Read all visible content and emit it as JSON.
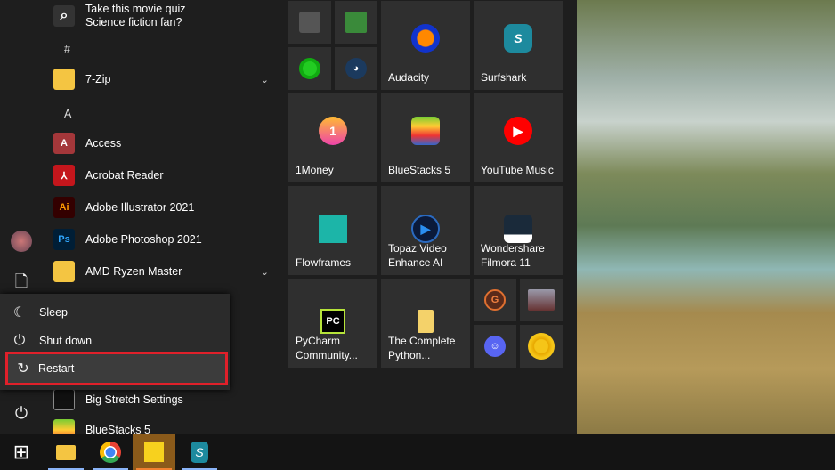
{
  "app_list": {
    "suggestion": {
      "line1": "Take this movie quiz",
      "line2": "Science fiction fan?",
      "icon": "search-icon"
    },
    "headers": [
      "#",
      "A"
    ],
    "items": [
      {
        "label": "7-Zip",
        "icon": "folder-icon",
        "expandable": true
      },
      {
        "label": "Access",
        "icon": "access-icon"
      },
      {
        "label": "Acrobat Reader",
        "icon": "acrobat-icon"
      },
      {
        "label": "Adobe Illustrator 2021",
        "icon": "illustrator-icon"
      },
      {
        "label": "Adobe Photoshop 2021",
        "icon": "photoshop-icon"
      },
      {
        "label": "AMD Ryzen Master",
        "icon": "folder-icon",
        "expandable": true
      },
      {
        "label": "Big Stretch Settings",
        "icon": "big-stretch-icon"
      },
      {
        "label": "BlueStacks 5",
        "icon": "bluestacks-icon"
      }
    ]
  },
  "power_menu": {
    "items": [
      {
        "label": "Sleep",
        "icon": "moon-icon"
      },
      {
        "label": "Shut down",
        "icon": "power-icon"
      },
      {
        "label": "Restart",
        "icon": "restart-icon",
        "highlighted": true
      }
    ],
    "highlight_color": "#e0202a"
  },
  "tiles": {
    "audacity": "Audacity",
    "surfshark": "Surfshark",
    "onemoney": "1Money",
    "bluestacks": "BlueStacks 5",
    "youtube_music": "YouTube Music",
    "flowframes": "Flowframes",
    "topaz": "Topaz Video Enhance AI",
    "filmora": "Wondershare Filmora 11",
    "pycharm": "PyCharm Community...",
    "python": "The Complete Python..."
  },
  "glyphs": {
    "suggestion": "⌕",
    "access": "A",
    "acrobat": "⅄",
    "illustrator": "Ai",
    "photoshop": "Ps",
    "chevron": "⌄",
    "sleep": "☾",
    "power": "⏻",
    "restart": "↻",
    "document": "🗋",
    "onemoney": "1",
    "youtube": "▶",
    "topaz": "▶",
    "pycharm": "PC",
    "grammarly": "G",
    "steam": "◕",
    "discord": "☺",
    "windows": "⊞",
    "surfshark": "S"
  }
}
